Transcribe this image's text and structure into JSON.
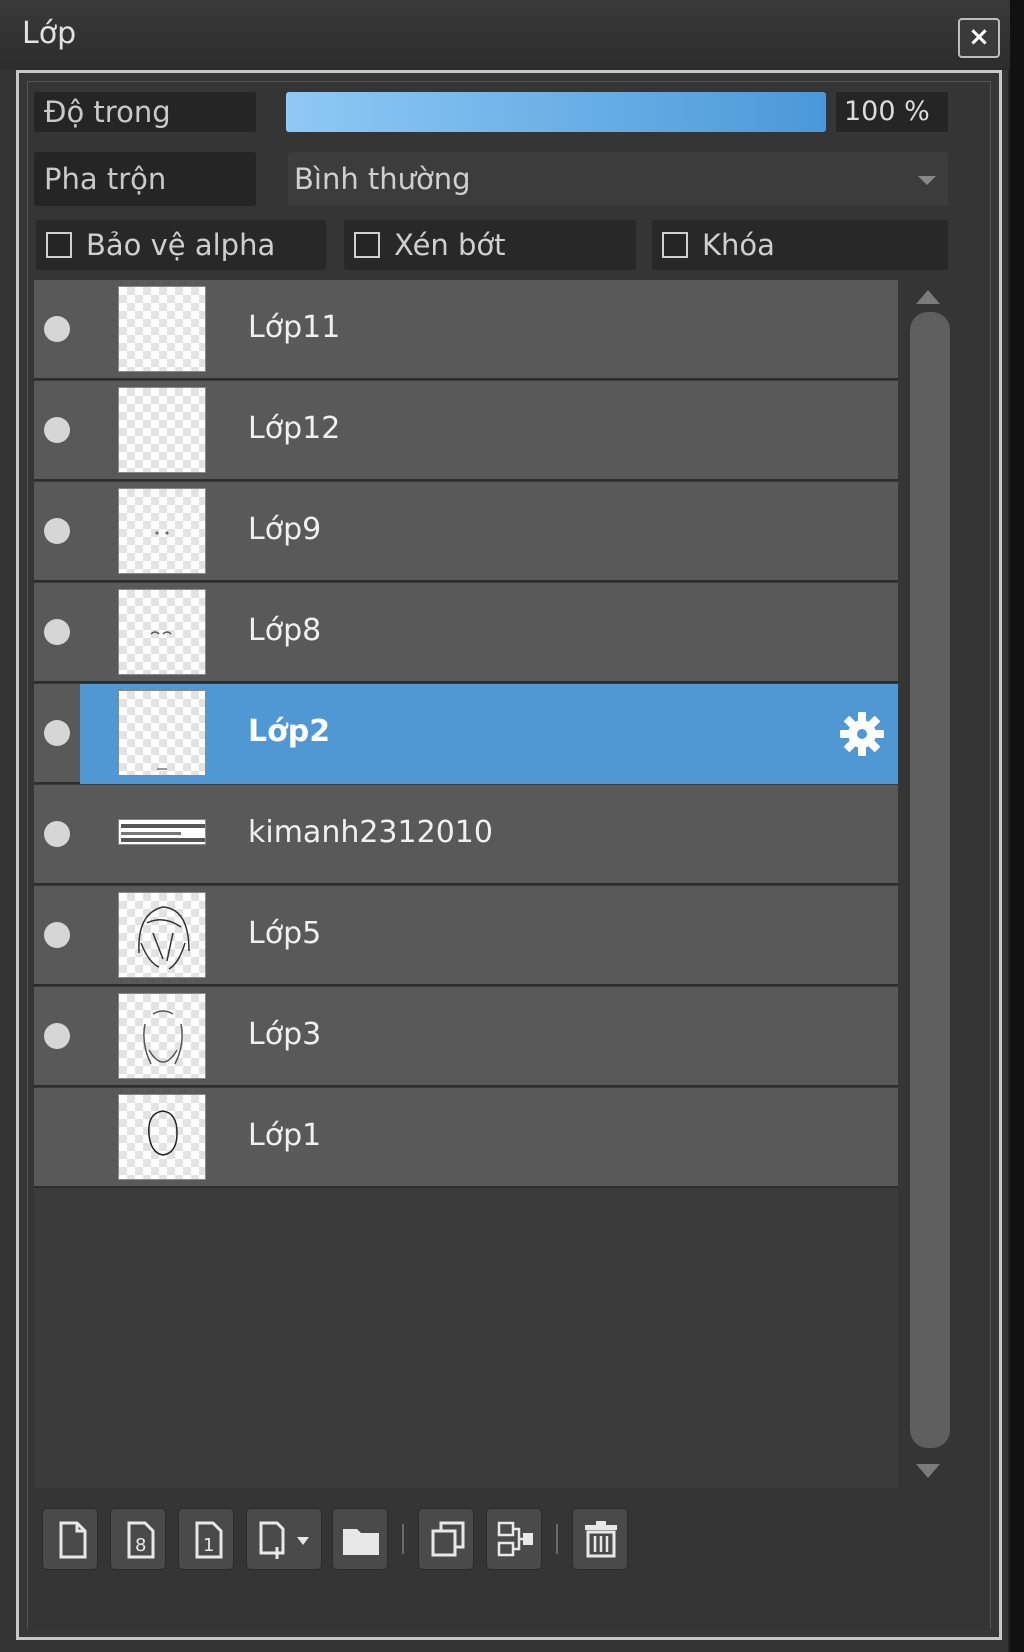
{
  "window": {
    "title": "Lớp",
    "close_label": "×"
  },
  "controls": {
    "opacity_label": "Độ trong",
    "opacity_value": "100 %",
    "opacity_fraction": 1.0,
    "blend_label": "Pha trộn",
    "blend_value": "Bình thường",
    "protect_alpha": {
      "label": "Bảo vệ alpha",
      "checked": false
    },
    "clipping": {
      "label": "Xén bớt",
      "checked": false
    },
    "lock": {
      "label": "Khóa",
      "checked": false
    }
  },
  "layers": [
    {
      "name": "Lớp11",
      "visible": true,
      "selected": false,
      "thumb": "empty"
    },
    {
      "name": "Lớp12",
      "visible": true,
      "selected": false,
      "thumb": "empty"
    },
    {
      "name": "Lớp9",
      "visible": true,
      "selected": false,
      "thumb": "dots"
    },
    {
      "name": "Lớp8",
      "visible": true,
      "selected": false,
      "thumb": "eyes"
    },
    {
      "name": "Lớp2",
      "visible": true,
      "selected": true,
      "thumb": "line"
    },
    {
      "name": "kimanh2312010",
      "visible": true,
      "selected": false,
      "thumb": "banner"
    },
    {
      "name": "Lớp5",
      "visible": true,
      "selected": false,
      "thumb": "hair"
    },
    {
      "name": "Lớp3",
      "visible": true,
      "selected": false,
      "thumb": "outline"
    },
    {
      "name": "Lớp1",
      "visible": false,
      "selected": false,
      "thumb": "face"
    }
  ],
  "toolbar_icons": [
    "new-layer-icon",
    "new-8bit-layer-icon",
    "new-1bit-layer-icon",
    "add-layer-menu-icon",
    "new-folder-icon",
    "duplicate-layer-icon",
    "merge-down-icon",
    "delete-layer-icon"
  ],
  "colors": {
    "selected": "#4f98d4",
    "row": "#595959",
    "panel": "#353535"
  }
}
